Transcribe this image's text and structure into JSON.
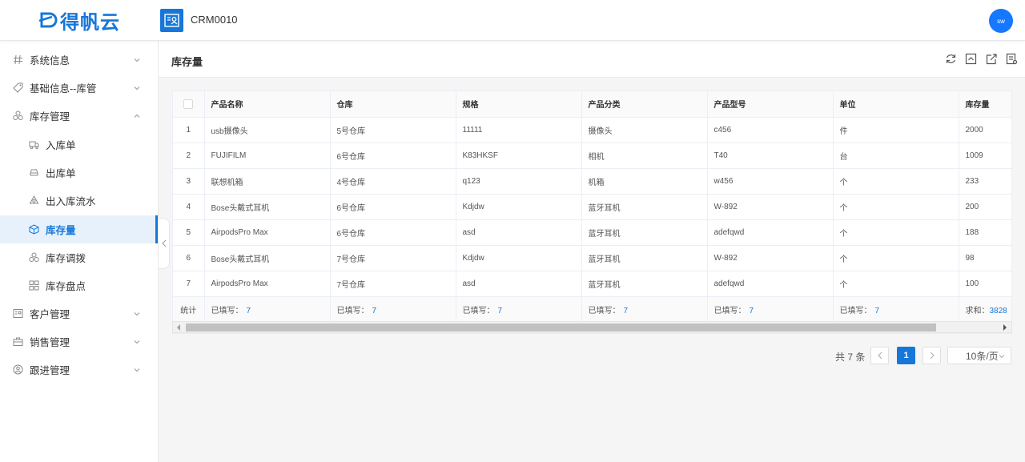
{
  "header": {
    "logo_text": "得帆云",
    "app_title": "CRM0010",
    "avatar_text": "sw",
    "brand_color": "#1677d9"
  },
  "sidebar": {
    "items": [
      {
        "label": "系统信息",
        "icon": "hash-icon",
        "expanded": false
      },
      {
        "label": "基础信息--库管",
        "icon": "tag-icon",
        "expanded": false
      },
      {
        "label": "库存管理",
        "icon": "cubes-icon",
        "expanded": true
      },
      {
        "label": "入库单",
        "icon": "truck-icon",
        "sub": true
      },
      {
        "label": "出库单",
        "icon": "car-icon",
        "sub": true
      },
      {
        "label": "出入库流水",
        "icon": "cycle-icon",
        "sub": true
      },
      {
        "label": "库存量",
        "icon": "box-icon",
        "sub": true,
        "active": true
      },
      {
        "label": "库存调拨",
        "icon": "cubes-icon",
        "sub": true
      },
      {
        "label": "库存盘点",
        "icon": "grid-icon",
        "sub": true
      },
      {
        "label": "客户管理",
        "icon": "contact-icon",
        "expanded": false
      },
      {
        "label": "销售管理",
        "icon": "briefcase-icon",
        "expanded": false
      },
      {
        "label": "跟进管理",
        "icon": "person-icon",
        "expanded": false
      }
    ]
  },
  "page": {
    "title": "库存量",
    "toolbar": [
      "refresh-icon",
      "collapse-icon",
      "export-icon",
      "settings-list-icon"
    ]
  },
  "table": {
    "columns": [
      "产品名称",
      "仓库",
      "规格",
      "产品分类",
      "产品型号",
      "单位",
      "库存量"
    ],
    "rows": [
      {
        "idx": "1",
        "cells": [
          "usb摄像头",
          "5号仓库",
          "11111",
          "摄像头",
          "c456",
          "件",
          "2000"
        ]
      },
      {
        "idx": "2",
        "cells": [
          "FUJIFILM",
          "6号仓库",
          "K83HKSF",
          "相机",
          "T40",
          "台",
          "1009"
        ]
      },
      {
        "idx": "3",
        "cells": [
          "联想机箱",
          "4号仓库",
          "q123",
          "机箱",
          "w456",
          "个",
          "233"
        ]
      },
      {
        "idx": "4",
        "cells": [
          "Bose头戴式耳机",
          "6号仓库",
          "Kdjdw",
          "蓝牙耳机",
          "W-892",
          "个",
          "200"
        ]
      },
      {
        "idx": "5",
        "cells": [
          "AirpodsPro Max",
          "6号仓库",
          "asd",
          "蓝牙耳机",
          "adefqwd",
          "个",
          "188"
        ]
      },
      {
        "idx": "6",
        "cells": [
          "Bose头戴式耳机",
          "7号仓库",
          "Kdjdw",
          "蓝牙耳机",
          "W-892",
          "个",
          "98"
        ]
      },
      {
        "idx": "7",
        "cells": [
          "AirpodsPro Max",
          "7号仓库",
          "asd",
          "蓝牙耳机",
          "adefqwd",
          "个",
          "100"
        ]
      }
    ],
    "footer": {
      "label": "统计",
      "filled_label": "已填写：",
      "filled_count": "7",
      "sum_label": "求和：",
      "sum_value": "3828"
    }
  },
  "pagination": {
    "total": "共 7 条",
    "current": "1",
    "page_size": "10条/页"
  }
}
